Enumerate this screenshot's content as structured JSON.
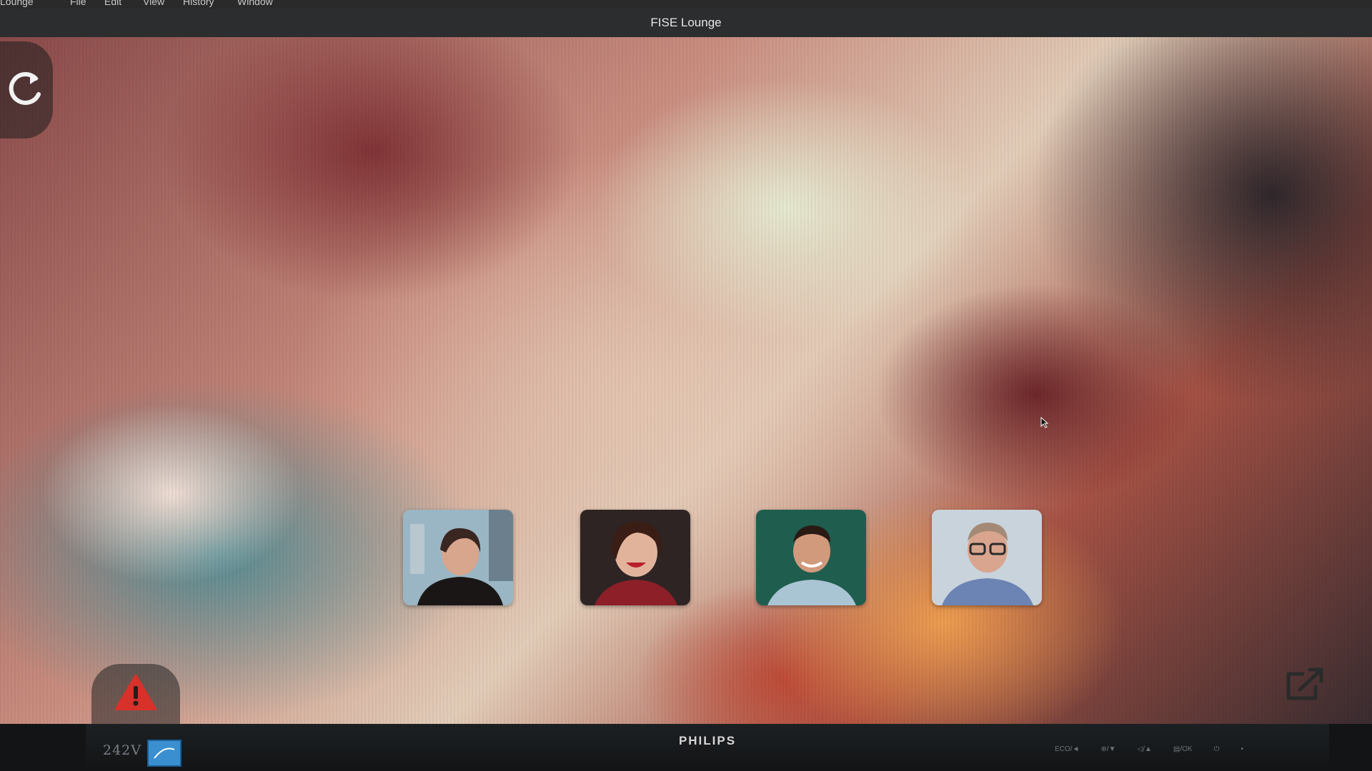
{
  "menubar": {
    "items": [
      "Lounge",
      "File",
      "Edit",
      "View",
      "History",
      "Window"
    ]
  },
  "window": {
    "title": "FISE Lounge"
  },
  "monitor": {
    "model": "242V",
    "brand": "PHILIPS",
    "controls": [
      "ECO/◄",
      "⊕/▼",
      "◁/▲",
      "▤/OK",
      "⏻",
      "•"
    ]
  },
  "participants": [
    {
      "avatar_icon": "person-avatar-icon",
      "tone": "#2f4858"
    },
    {
      "avatar_icon": "person-avatar-icon",
      "tone": "#3a2b2b"
    },
    {
      "avatar_icon": "person-avatar-icon",
      "tone": "#1f5d4f"
    },
    {
      "avatar_icon": "person-avatar-icon",
      "tone": "#8fa3b8"
    }
  ],
  "icons": {
    "refresh": "refresh-icon",
    "warning": "warning-icon",
    "external": "open-external-icon"
  },
  "colors": {
    "warning": "#d8312a",
    "titlebar": "#2b2d2e"
  }
}
